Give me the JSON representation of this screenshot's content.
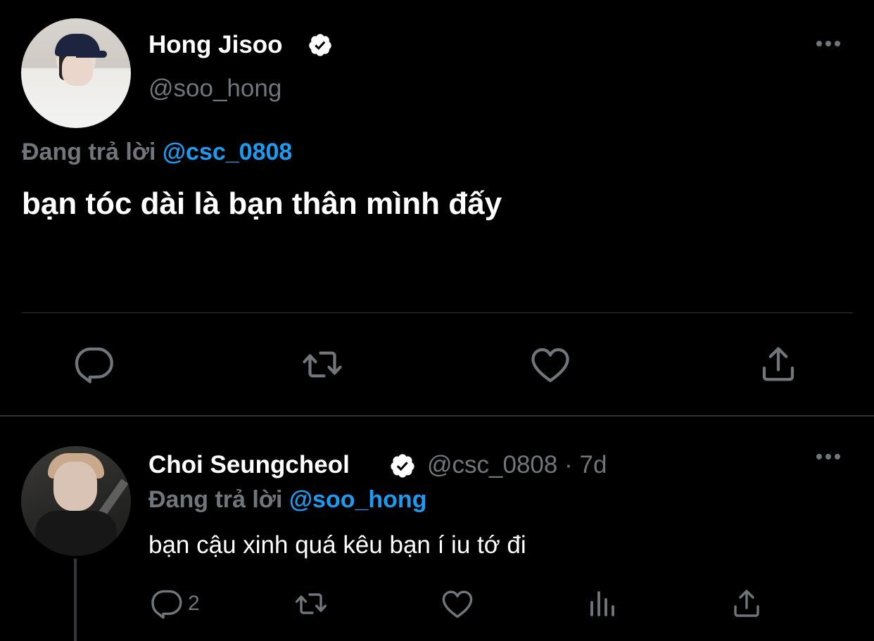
{
  "main_tweet": {
    "author_name": "Hong Jisoo",
    "author_handle": "@soo_hong",
    "verified_icon": "verified-badge-icon",
    "replying_prefix": "Đang trả lời",
    "replying_to": "@csc_0808",
    "text": "bạn tóc dài là bạn thân mình đấy",
    "actions": [
      "reply-icon",
      "retweet-icon",
      "like-icon",
      "share-icon"
    ]
  },
  "reply_tweet": {
    "author_name": "Choi Seungcheol",
    "author_handle": "@csc_0808",
    "separator": "·",
    "time": "7d",
    "replying_prefix": "Đang trả lời",
    "replying_to": "@soo_hong",
    "text": "bạn cậu xinh quá kêu bạn í iu tớ đi",
    "reply_count": "2",
    "actions": [
      "reply-icon",
      "retweet-icon",
      "like-icon",
      "analytics-icon",
      "share-icon"
    ]
  },
  "colors": {
    "background": "#000000",
    "text": "#ffffff",
    "secondary": "#71767b",
    "accent": "#1d9bf0",
    "divider": "#2f3336"
  }
}
